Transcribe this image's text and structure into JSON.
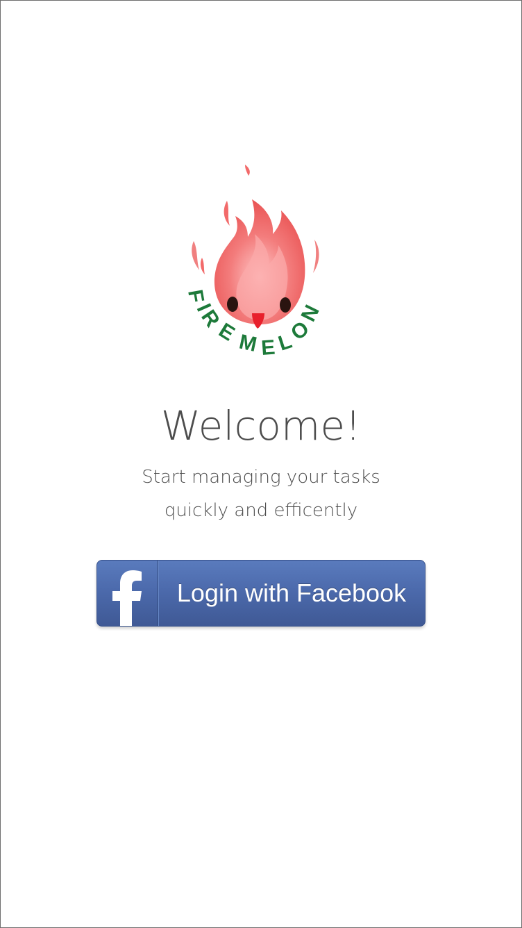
{
  "brand": {
    "logo_text": "FIREMELON",
    "logo_name": "firemelon-logo"
  },
  "welcome": {
    "title": "Welcome!",
    "subtitle_line1": "Start managing your tasks",
    "subtitle_line2": "quickly and efficently"
  },
  "login": {
    "facebook_label": "Login with Facebook",
    "icon": "facebook-f-icon"
  },
  "colors": {
    "facebook_blue": "#4c6aac",
    "flame_red": "#f26a6a",
    "logo_green": "#1d7a3a",
    "text_gray": "#4d4d4d"
  }
}
